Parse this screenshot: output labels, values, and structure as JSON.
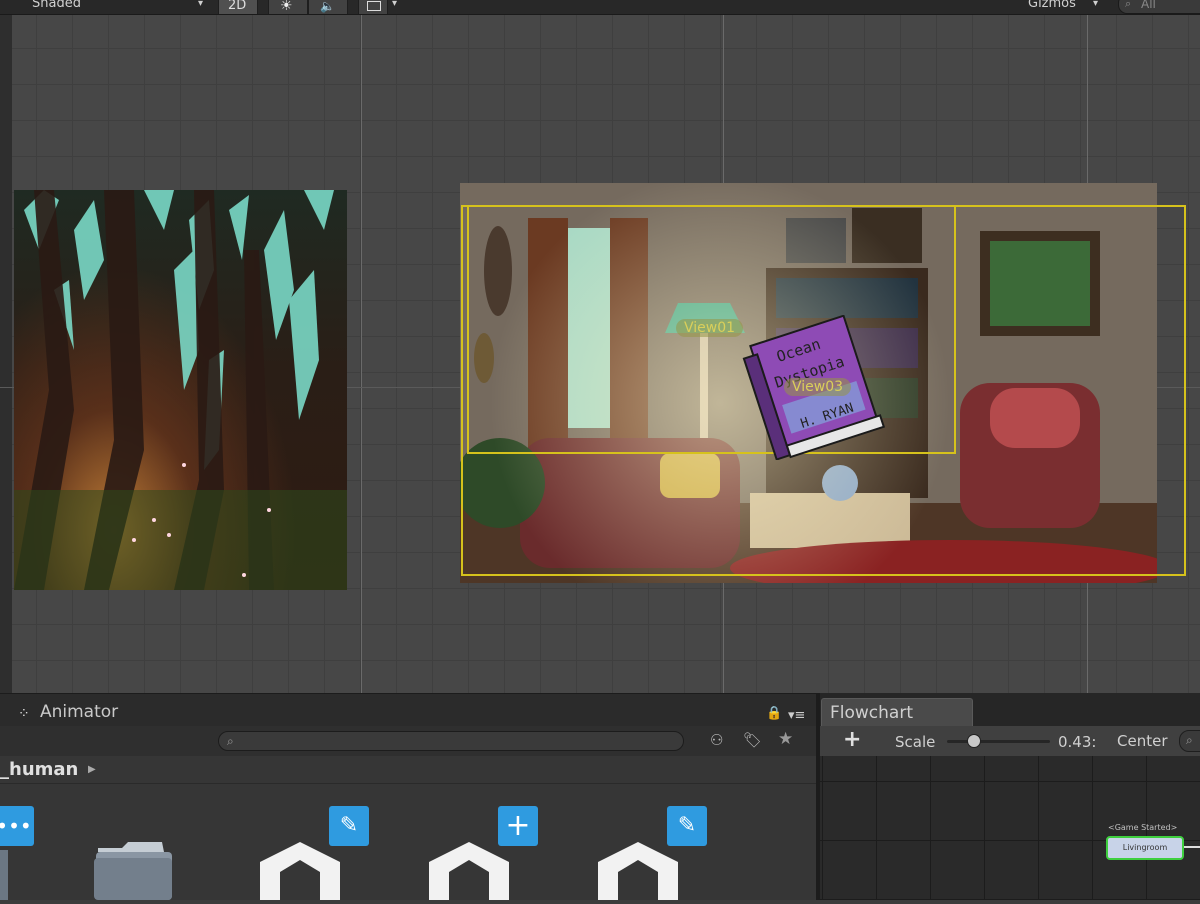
{
  "scene_toolbar": {
    "shading_mode": "Shaded",
    "mode_2d_label": "2D",
    "gizmos_label": "Gizmos",
    "search_placeholder": "All"
  },
  "scene": {
    "view_labels": [
      "View01",
      "View03"
    ],
    "book": {
      "title_line1": "Ocean",
      "title_line2": "Dystopia",
      "author": "H. RYAN"
    }
  },
  "animator": {
    "tab_label": "Animator",
    "search_placeholder": "",
    "breadcrumb": "_human"
  },
  "flowchart": {
    "tab_label": "Flowchart",
    "add_label": "+",
    "scale_label": "Scale",
    "scale_value": "0.43:",
    "scale_slider_fraction": 0.26,
    "center_label": "Center",
    "node_event": "<Game Started>",
    "node_label": "Livingroom"
  },
  "colors": {
    "accent_blue": "#2f9be0",
    "view_rect_yellow": "#d6c21c",
    "node_border_green": "#3ecf3e"
  }
}
